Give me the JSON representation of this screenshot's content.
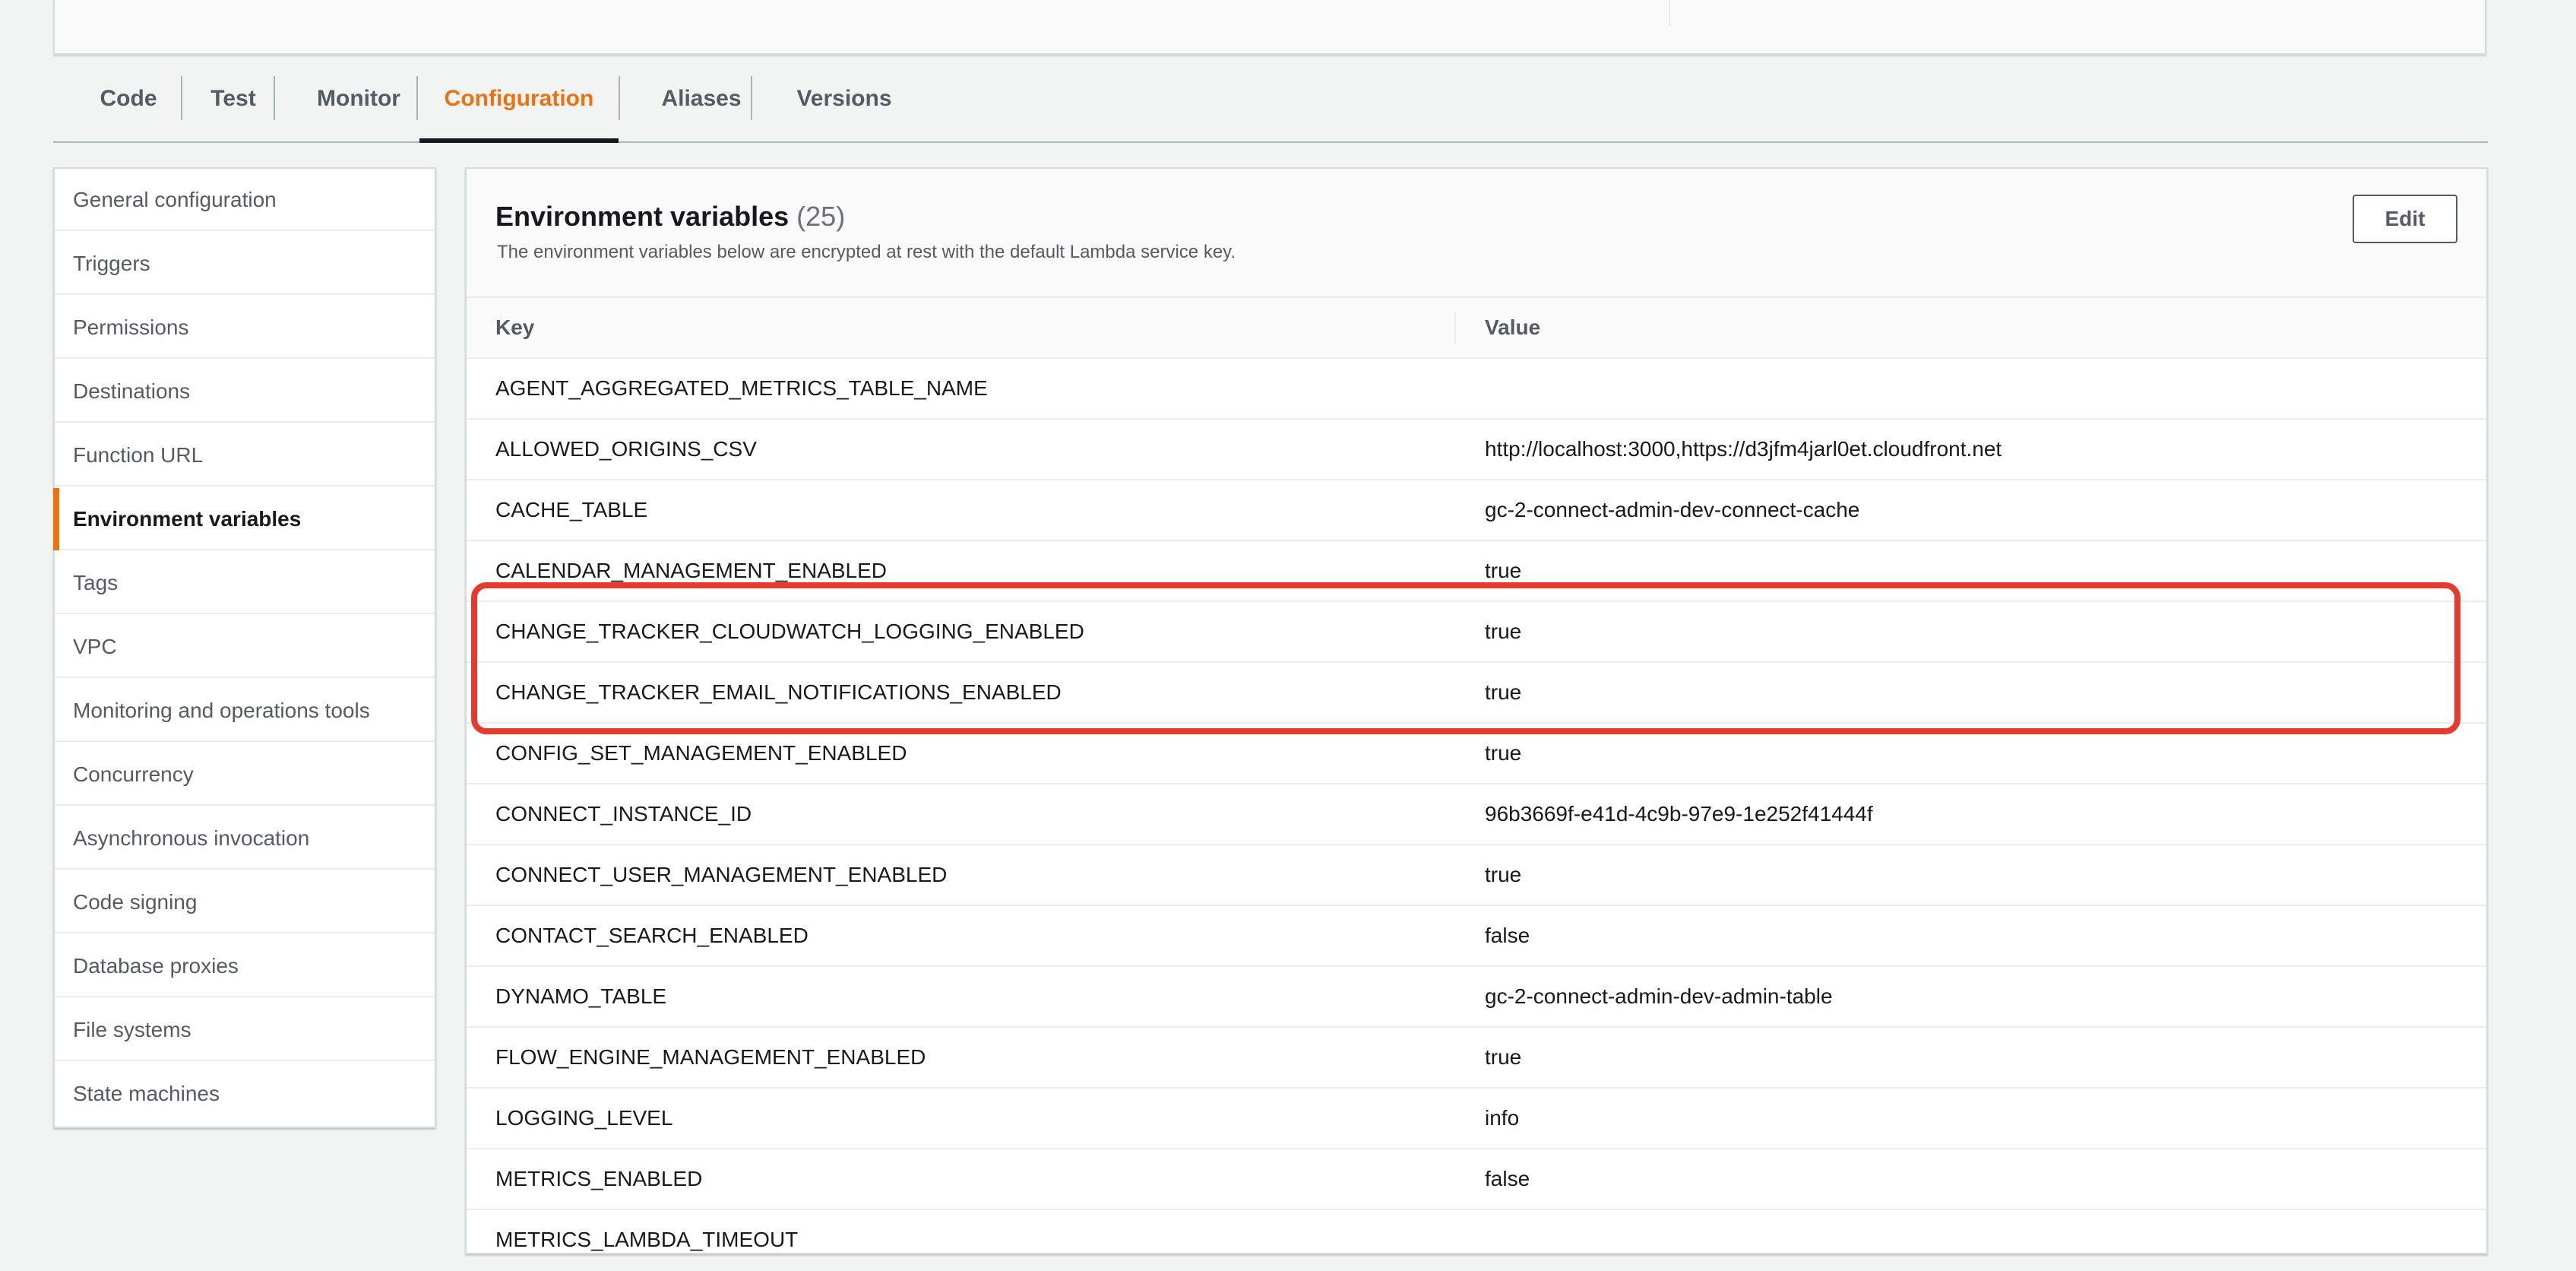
{
  "tabs": [
    {
      "label": "Code"
    },
    {
      "label": "Test"
    },
    {
      "label": "Monitor"
    },
    {
      "label": "Configuration"
    },
    {
      "label": "Aliases"
    },
    {
      "label": "Versions"
    }
  ],
  "active_tab": "Configuration",
  "sidebar": {
    "active": "Environment variables",
    "items": [
      {
        "label": "General configuration"
      },
      {
        "label": "Triggers"
      },
      {
        "label": "Permissions"
      },
      {
        "label": "Destinations"
      },
      {
        "label": "Function URL"
      },
      {
        "label": "Environment variables"
      },
      {
        "label": "Tags"
      },
      {
        "label": "VPC"
      },
      {
        "label": "Monitoring and operations tools"
      },
      {
        "label": "Concurrency"
      },
      {
        "label": "Asynchronous invocation"
      },
      {
        "label": "Code signing"
      },
      {
        "label": "Database proxies"
      },
      {
        "label": "File systems"
      },
      {
        "label": "State machines"
      }
    ]
  },
  "env": {
    "title": "Environment variables",
    "count": "(25)",
    "description": "The environment variables below are encrypted at rest with the default Lambda service key.",
    "edit_label": "Edit",
    "columns": {
      "key": "Key",
      "value": "Value"
    },
    "rows": [
      {
        "key": "AGENT_AGGREGATED_METRICS_TABLE_NAME",
        "value": ""
      },
      {
        "key": "ALLOWED_ORIGINS_CSV",
        "value": "http://localhost:3000,https://d3jfm4jarl0et.cloudfront.net"
      },
      {
        "key": "CACHE_TABLE",
        "value": "gc-2-connect-admin-dev-connect-cache"
      },
      {
        "key": "CALENDAR_MANAGEMENT_ENABLED",
        "value": "true"
      },
      {
        "key": "CHANGE_TRACKER_CLOUDWATCH_LOGGING_ENABLED",
        "value": "true"
      },
      {
        "key": "CHANGE_TRACKER_EMAIL_NOTIFICATIONS_ENABLED",
        "value": "true"
      },
      {
        "key": "CONFIG_SET_MANAGEMENT_ENABLED",
        "value": "true"
      },
      {
        "key": "CONNECT_INSTANCE_ID",
        "value": "96b3669f-e41d-4c9b-97e9-1e252f41444f"
      },
      {
        "key": "CONNECT_USER_MANAGEMENT_ENABLED",
        "value": "true"
      },
      {
        "key": "CONTACT_SEARCH_ENABLED",
        "value": "false"
      },
      {
        "key": "DYNAMO_TABLE",
        "value": "gc-2-connect-admin-dev-admin-table"
      },
      {
        "key": "FLOW_ENGINE_MANAGEMENT_ENABLED",
        "value": "true"
      },
      {
        "key": "LOGGING_LEVEL",
        "value": "info"
      },
      {
        "key": "METRICS_ENABLED",
        "value": "false"
      },
      {
        "key": "METRICS_LAMBDA_TIMEOUT",
        "value": ""
      }
    ]
  },
  "highlight_color": "#e53b2e",
  "accent_color": "#ec7211"
}
